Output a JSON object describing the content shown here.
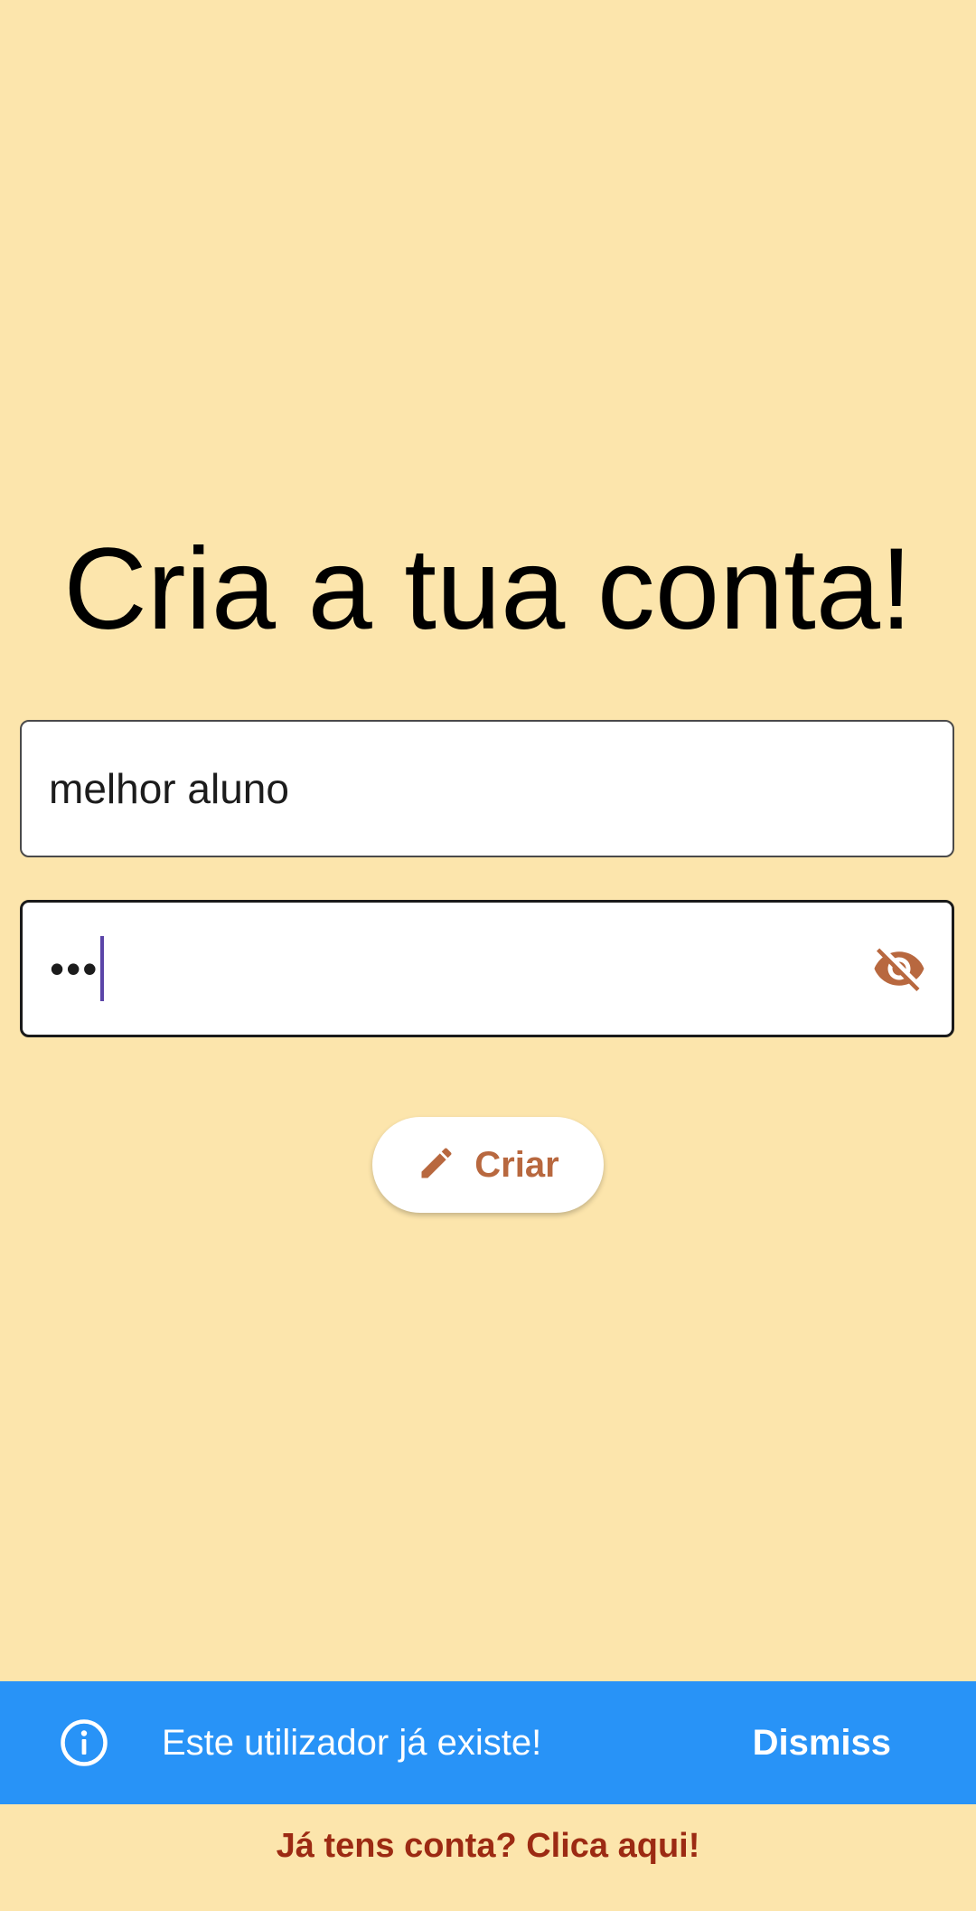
{
  "page": {
    "title": "Cria a tua conta!"
  },
  "form": {
    "username_value": "melhor aluno",
    "password_value": "•••",
    "visibility_icon": "visibility-off-icon"
  },
  "create_button": {
    "label": "Criar",
    "icon": "pencil-icon"
  },
  "snackbar": {
    "icon": "info-icon",
    "message": "Este utilizador já existe!",
    "action_label": "Dismiss"
  },
  "login_link": {
    "label": "Já tens conta? Clica aqui!"
  },
  "colors": {
    "background": "#fce5ac",
    "accent": "#b8683f",
    "snackbar": "#2893f7",
    "link": "#9c2a13",
    "caret": "#5b45a8"
  }
}
